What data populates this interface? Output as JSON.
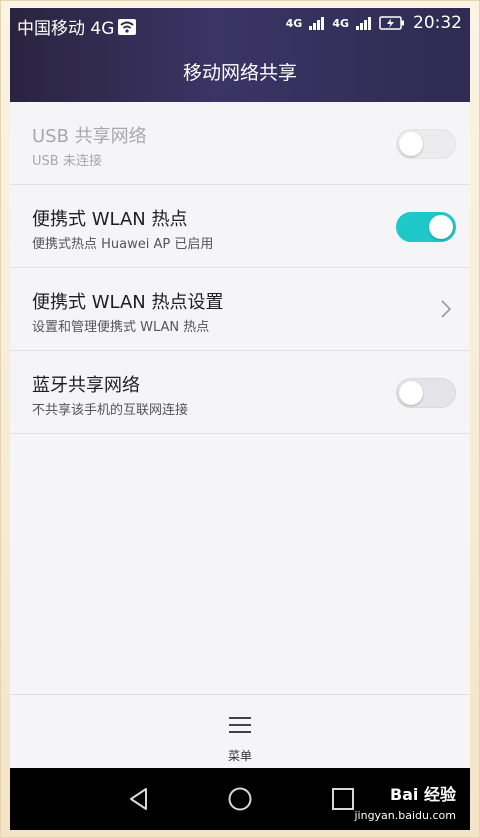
{
  "status_bar": {
    "carrier": "中国移动 4G",
    "net_tag_1": "4G",
    "net_tag_2": "4G",
    "time": "20:32"
  },
  "header": {
    "title": "移动网络共享"
  },
  "settings": [
    {
      "title": "USB 共享网络",
      "subtitle": "USB 未连接",
      "control": "toggle",
      "state": "off",
      "enabled": false
    },
    {
      "title": "便携式 WLAN 热点",
      "subtitle": "便携式热点 Huawei AP 已启用",
      "control": "toggle",
      "state": "on",
      "enabled": true
    },
    {
      "title": "便携式 WLAN 热点设置",
      "subtitle": "设置和管理便携式 WLAN 热点",
      "control": "chevron",
      "enabled": true
    },
    {
      "title": "蓝牙共享网络",
      "subtitle": "不共享该手机的互联网连接",
      "control": "toggle",
      "state": "off",
      "enabled": true
    }
  ],
  "bottom_bar": {
    "menu_label": "菜单",
    "menu_icon": "menu-icon"
  },
  "nav_bar": {
    "icons": [
      "back-icon",
      "home-icon",
      "recents-icon"
    ]
  },
  "watermark": {
    "logo": "Bai 经验",
    "url": "jingyan.baidu.com"
  },
  "colors": {
    "header_start": "#2a2440",
    "header_end": "#2f2b52",
    "toggle_on": "#1ec8c8",
    "background": "#f5f4f7"
  }
}
